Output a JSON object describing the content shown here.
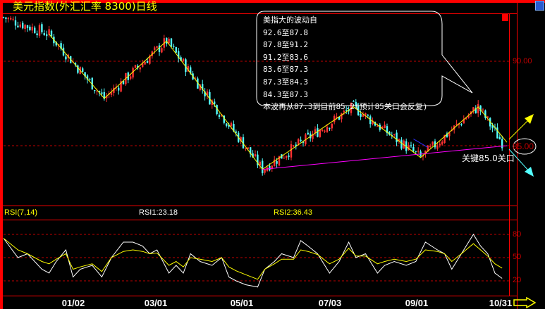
{
  "title": "美元指数(外汇汇率 8300)日线",
  "annotation": {
    "heading": "美指大的波动自",
    "lines": [
      "92.6至87.8",
      "87.8至91.2",
      "91.2至83.6",
      "83.6至87.3",
      "87.3至84.3",
      "84.3至87.3"
    ],
    "summary": "本波再从87.3到目前85.2(预计85关口会反复)"
  },
  "key_level_label": "关键85.0关口",
  "key_level_value": "85.00",
  "price_axis": {
    "ticks": [
      "90.00",
      "85.00"
    ]
  },
  "rsi": {
    "label": "RSI(7,14)",
    "rsi1": "RSI1:23.18",
    "rsi2": "RSI2:36.43",
    "ticks": [
      "80",
      "50",
      "20"
    ]
  },
  "colors": {
    "up": "#ff3232",
    "down": "#54ffff",
    "frame": "#ff0000",
    "grid": "#c00000",
    "zigzag": "#ffff00",
    "support": "#ff00ff",
    "rsi1": "#ffffff",
    "rsi2": "#ffff00"
  },
  "chart_data": [
    {
      "type": "candlestick",
      "title": "美元指数(外汇汇率 8300)日线",
      "x_ticks": [
        {
          "index": 29,
          "label": "01/02"
        },
        {
          "index": 63,
          "label": "03/01"
        },
        {
          "index": 99,
          "label": "05/01"
        },
        {
          "index": 136,
          "label": "07/03"
        },
        {
          "index": 172,
          "label": "09/01"
        },
        {
          "index": 208,
          "label": "10/31"
        }
      ],
      "ylim": [
        82.9,
        93.6
      ],
      "wave_pivots": [
        [
          0,
          92.6
        ],
        [
          19,
          91.6
        ],
        [
          42,
          87.8
        ],
        [
          68,
          91.2
        ],
        [
          108,
          83.6
        ],
        [
          146,
          87.3
        ],
        [
          174,
          84.3
        ],
        [
          198,
          87.3
        ],
        [
          208,
          85.2
        ]
      ],
      "zigzag": [
        [
          19,
          91.6
        ],
        [
          42,
          87.8
        ],
        [
          68,
          91.2
        ],
        [
          108,
          83.6
        ],
        [
          146,
          87.3
        ],
        [
          174,
          84.3
        ],
        [
          198,
          87.3
        ],
        [
          210,
          85.2
        ]
      ],
      "support_line": [
        [
          108,
          83.6
        ],
        [
          210,
          85.0
        ]
      ],
      "blue_line": [
        [
          171,
          85.4
        ],
        [
          177,
          84.9
        ]
      ],
      "horizontal_levels": [
        90.0,
        85.0
      ],
      "last_close": 85.2
    },
    {
      "type": "line",
      "title": "RSI(7,14)",
      "ylim": [
        0,
        100
      ],
      "levels": [
        80,
        50,
        20
      ],
      "x_index": [
        0,
        6,
        10,
        16,
        19,
        22,
        26,
        29,
        32,
        37,
        41,
        45,
        50,
        54,
        58,
        61,
        64,
        69,
        72,
        75,
        78,
        82,
        87,
        91,
        94,
        97,
        101,
        106,
        109,
        113,
        116,
        121,
        124,
        127,
        131,
        136,
        140,
        144,
        147,
        151,
        156,
        159,
        163,
        168,
        172,
        176,
        181,
        184,
        187,
        191,
        196,
        199,
        202,
        205,
        208
      ],
      "series": [
        {
          "name": "RSI1",
          "values": [
            75,
            50,
            55,
            35,
            30,
            45,
            60,
            25,
            35,
            40,
            25,
            50,
            70,
            70,
            65,
            55,
            60,
            30,
            40,
            30,
            55,
            45,
            40,
            50,
            25,
            20,
            15,
            12,
            35,
            45,
            55,
            50,
            72,
            65,
            55,
            30,
            45,
            70,
            50,
            55,
            30,
            40,
            45,
            40,
            45,
            70,
            60,
            55,
            35,
            55,
            80,
            65,
            55,
            30,
            23.18
          ]
        },
        {
          "name": "RSI2",
          "values": [
            75,
            60,
            55,
            45,
            42,
            48,
            55,
            35,
            38,
            42,
            32,
            50,
            58,
            60,
            58,
            55,
            56,
            40,
            45,
            38,
            50,
            48,
            45,
            50,
            38,
            33,
            28,
            22,
            35,
            42,
            48,
            48,
            60,
            58,
            54,
            42,
            48,
            62,
            52,
            52,
            42,
            45,
            48,
            45,
            48,
            60,
            58,
            55,
            45,
            55,
            68,
            60,
            52,
            42,
            36.43
          ]
        }
      ]
    }
  ]
}
